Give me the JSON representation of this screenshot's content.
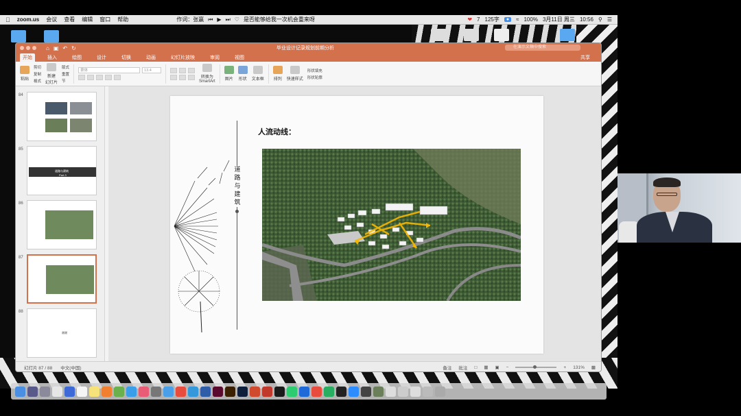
{
  "menubar": {
    "app": "zoom.us",
    "menus": [
      "会议",
      "查看",
      "编辑",
      "窗口",
      "帮助"
    ],
    "lyric_label": "作词：张赢",
    "now_playing": "是否能够给我一次机会重来呀",
    "count": "7",
    "chars": "125字",
    "battery": "100%",
    "date": "3月11日 周三",
    "time": "10:56"
  },
  "ppt": {
    "doc_title": "毕业设计记录规划前期分析",
    "search_placeholder": "在演示文稿中搜索",
    "share": "共享",
    "tabs": [
      "开始",
      "插入",
      "绘图",
      "设计",
      "切换",
      "动画",
      "幻灯片放映",
      "审阅",
      "视图"
    ],
    "ribbon": {
      "paste": "粘贴",
      "cut": "剪切",
      "copy": "复制",
      "format": "格式",
      "new_slide": "新建\n幻灯片",
      "layout": "版式",
      "reset": "重置",
      "section": "节",
      "font_placeholder": "隶体",
      "font_size": "13.4",
      "convert_smartart": "转换为\nSmartArt",
      "picture": "图片",
      "shape": "形状",
      "textbox": "文本框",
      "arrange": "排列",
      "quick_styles": "快速样式",
      "shape_fill": "形状填充",
      "shape_outline": "形状轮廓"
    },
    "thumbnails": [
      {
        "num": "84",
        "caption": ""
      },
      {
        "num": "85",
        "caption": "道路与建筑",
        "sub": "Part.3"
      },
      {
        "num": "86",
        "caption": ""
      },
      {
        "num": "87",
        "caption": ""
      },
      {
        "num": "88",
        "caption": "谢谢"
      }
    ],
    "slide": {
      "title": "人流动线：",
      "vertical_text": "道路与建筑"
    },
    "status": {
      "slide_counter": "幻灯片 87 / 88",
      "language": "中文(中国)",
      "notes": "备注",
      "comments": "批注",
      "zoom": "131%"
    }
  },
  "colors": {
    "accent": "#d3714d",
    "flow_arrow": "#f5b800"
  }
}
